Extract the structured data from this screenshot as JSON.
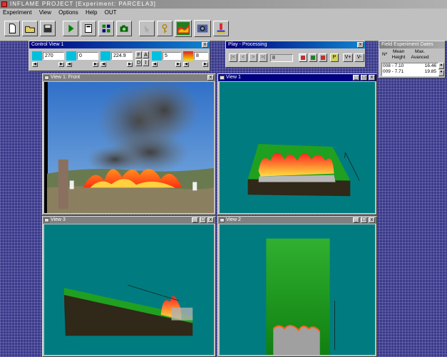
{
  "app": {
    "title": "INFLAME  PROJECT [Experiment: PARCELA3]"
  },
  "menu": [
    "Experiment",
    "View",
    "Options",
    "Help",
    "OUT"
  ],
  "toolbar": {
    "buttons": [
      "new-file-icon",
      "open-folder-icon",
      "save-icon",
      "play-icon",
      "calculator-icon",
      "grid-icon",
      "camera-icon",
      "pointer-icon",
      "help-key-icon",
      "flame-map-icon",
      "camera-3d-icon",
      "thermometer-icon"
    ]
  },
  "control_view": {
    "title": "Control View 1",
    "angle1": "270",
    "angle2": "0",
    "distance": "224.9",
    "buttons": [
      "F",
      "A",
      "D",
      "I"
    ],
    "scale": "5",
    "level": "8"
  },
  "play": {
    "title": "Play - Processing",
    "frame": "8",
    "buttons": [
      "|<",
      "<",
      ">",
      ">|"
    ],
    "p_label": "P",
    "v_plus": "V+",
    "v_minus": "V-"
  },
  "field_dates": {
    "title": "Field Experiment Dates",
    "headers": [
      "Nº",
      "Mean Height",
      "Max. Avanced"
    ],
    "rows": [
      {
        "n": "008 - 7.10",
        "v": "16.46"
      },
      {
        "n": "009 - 7.71",
        "v": "19.85"
      }
    ]
  },
  "views": {
    "front": "View 1: Front",
    "v1": "View 1",
    "v3": "View 3",
    "v2": "View 2"
  },
  "colors": {
    "viewport": "#007c80",
    "active_title": "#000080",
    "inactive_title": "#808080"
  }
}
